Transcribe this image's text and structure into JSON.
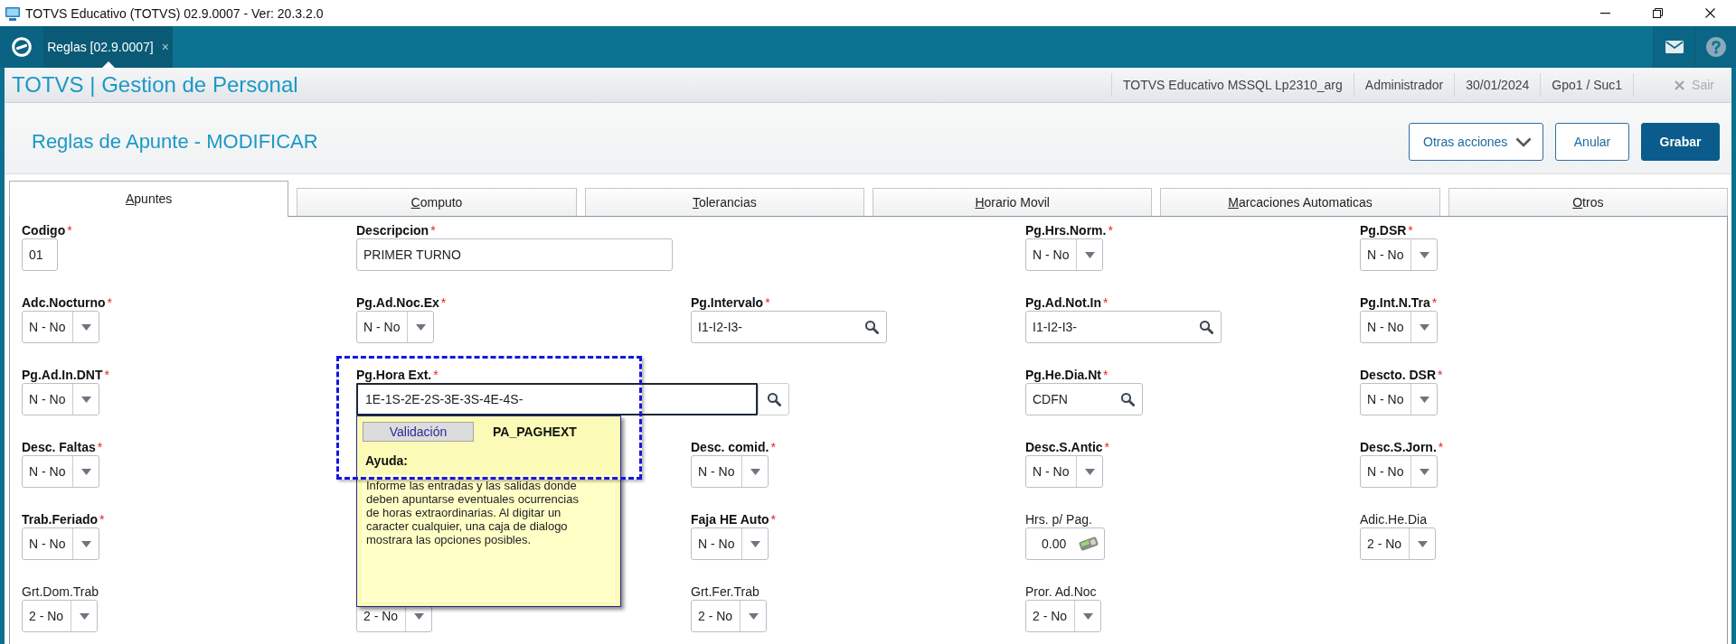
{
  "window": {
    "title": "TOTVS Educativo (TOTVS) 02.9.0007 - Ver: 20.3.2.0"
  },
  "top_bar": {
    "tabs": [
      {
        "label": "Reglas [02.9.0007]",
        "close": "×",
        "selected": true
      }
    ]
  },
  "header": {
    "title": "TOTVS | Gestion de Personal",
    "info": [
      "TOTVS Educativo MSSQL Lp2310_arg",
      "Administrador",
      "30/01/2024",
      "Gpo1 / Suc1"
    ],
    "exit": {
      "label": "Sair",
      "disabled": true
    }
  },
  "page": {
    "title": "Reglas de Apunte - MODIFICAR",
    "buttons": [
      {
        "label": "Otras acciones",
        "kind": "menu"
      },
      {
        "label": "Anular",
        "kind": "secondary"
      },
      {
        "label": "Grabar",
        "kind": "primary"
      }
    ]
  },
  "form_tabs": [
    {
      "label": "Apuntes",
      "selected": true
    },
    {
      "label": "Computo",
      "selected": false
    },
    {
      "label": "Tolerancias",
      "selected": false
    },
    {
      "label": "Horario Movil",
      "selected": false
    },
    {
      "label": "Marcaciones Automaticas",
      "selected": false
    },
    {
      "label": "Otros",
      "selected": false
    }
  ],
  "form": {
    "rows": [
      [
        {
          "kind": "text",
          "label": "Codigo",
          "mark": "*",
          "value": "01",
          "focused": false
        },
        {
          "kind": "text",
          "label": "Descripcion",
          "mark": "*",
          "value": "PRIMER TURNO",
          "focused": false
        },
        null,
        {
          "kind": "select",
          "label": "Pg.Hrs.Norm.",
          "mark": "*",
          "value": "N - No",
          "focused": false
        },
        {
          "kind": "select",
          "label": "Pg.DSR",
          "mark": "*",
          "value": "N - No",
          "focused": false
        }
      ],
      [
        {
          "kind": "select",
          "label": "Adc.Nocturno",
          "mark": "*",
          "value": "N - No",
          "focused": false
        },
        {
          "kind": "select",
          "label": "Pg.Ad.Noc.Ex",
          "mark": "*",
          "value": "N - No",
          "focused": false
        },
        {
          "kind": "lookup",
          "label": "Pg.Intervalo",
          "mark": "*",
          "value": "I1-I2-I3-",
          "focused": false
        },
        {
          "kind": "lookup",
          "label": "Pg.Ad.Not.In",
          "mark": "*",
          "value": "I1-I2-I3-",
          "focused": false
        },
        {
          "kind": "select",
          "label": "Pg.Int.N.Tra",
          "mark": "*",
          "value": "N - No",
          "focused": false
        }
      ],
      [
        {
          "kind": "select",
          "label": "Pg.Ad.In.DNT",
          "mark": "*",
          "value": "N - No",
          "focused": false
        },
        {
          "kind": "lookup",
          "label": "Pg.Hora Ext.",
          "mark": "*",
          "value": "1E-1S-2E-2S-3E-3S-4E-4S-",
          "focused": true,
          "help_popup": {
            "button": "Validación",
            "code": "PA_PAGHEXT",
            "heading": "Ayuda:",
            "text": "Informe las entradas y las salidas donde deben apuntarse eventuales ocurrencias de horas extraordinarias. Al digitar un caracter cualquier, una caja de dialogo mostrara las opciones posibles."
          }
        },
        null,
        {
          "kind": "lookup",
          "label": "Pg.He.Dia.Nt",
          "mark": "*",
          "value": "CDFN",
          "focused": false
        },
        {
          "kind": "select",
          "label": "Descto. DSR",
          "mark": "*",
          "value": "N - No",
          "focused": false
        }
      ],
      [
        {
          "kind": "select",
          "label": "Desc. Faltas",
          "mark": "*",
          "value": "N - No",
          "focused": false
        },
        null,
        {
          "kind": "select",
          "label": "Desc. comid.",
          "mark": "*",
          "value": "N - No",
          "focused": false
        },
        {
          "kind": "select",
          "label": "Desc.S.Antic",
          "mark": "*",
          "value": "N - No",
          "focused": false
        },
        {
          "kind": "select",
          "label": "Desc.S.Jorn.",
          "mark": "*",
          "value": "N - No",
          "focused": false
        }
      ],
      [
        {
          "kind": "select",
          "label": "Trab.Feriado",
          "mark": "*",
          "value": "N - No",
          "focused": false
        },
        null,
        {
          "kind": "select",
          "label": "Faja HE Auto",
          "mark": "*",
          "value": "N - No",
          "focused": false
        },
        {
          "kind": "number",
          "label": "Hrs. p/ Pag.",
          "value": "0.00",
          "focused": false
        },
        {
          "kind": "select",
          "label": "Adic.He.Dia",
          "value": "2 - No",
          "focused": false
        }
      ],
      [
        {
          "kind": "select",
          "label": "Grt.Dom.Trab",
          "value": "2 - No",
          "focused": false
        },
        {
          "kind": "select",
          "value": "2 - No",
          "focused": false
        },
        {
          "kind": "select",
          "label": "Grt.Fer.Trab",
          "value": "2 - No",
          "focused": false
        },
        {
          "kind": "select",
          "label": "Pror. Ad.Noc",
          "value": "2 - No",
          "focused": false
        },
        null
      ]
    ]
  }
}
